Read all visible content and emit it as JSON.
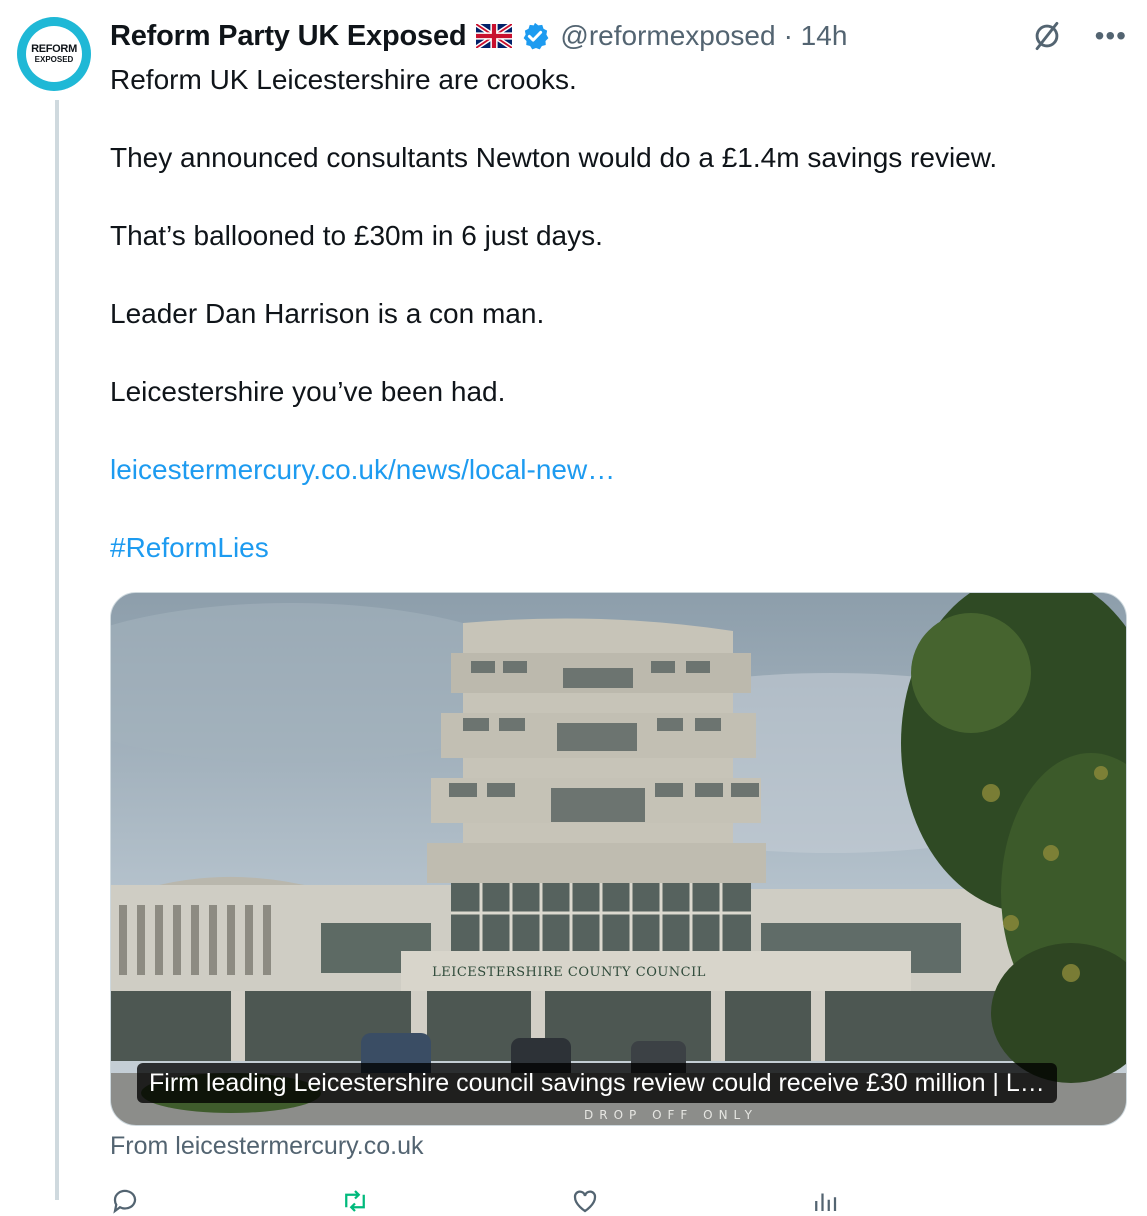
{
  "author": {
    "name": "Reform Party UK Exposed",
    "handle": "@reformexposed",
    "time": "· 14h",
    "avatar_line1": "REFORM",
    "avatar_line2": "EXPOSED",
    "verified": true,
    "flag": "uk-flag-icon"
  },
  "tweet": {
    "paragraphs": [
      "Reform UK Leicestershire are crooks.",
      "They announced consultants Newton would do a £1.4m savings review.",
      "That’s ballooned to £30m in 6 just days.",
      "Leader Dan Harrison is a con man.",
      "Leicestershire you’ve been had."
    ],
    "link": "leicestermercury.co.uk/news/local-new…",
    "hashtag": "#ReformLies"
  },
  "card": {
    "building_sign": "LEICESTERSHIRE COUNTY COUNCIL",
    "caption": "Firm leading Leicestershire council savings review could receive £30 million | L…",
    "source": "From leicestermercury.co.uk",
    "road_marking": "DROP OFF ONLY"
  },
  "colors": {
    "link": "#1d9bf0",
    "secondary_text": "#536471",
    "verified": "#1d9bf0",
    "avatar_ring": "#1fb8d6"
  },
  "icons": {
    "grok": "grok-icon",
    "more": "more-icon",
    "reply": "reply-icon",
    "retweet": "retweet-icon",
    "like": "like-icon",
    "views": "views-icon"
  }
}
